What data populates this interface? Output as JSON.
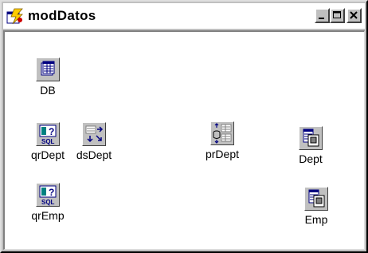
{
  "window": {
    "title": "modDatos",
    "title_color": "#000000",
    "app_icon": "delphi-form-icon",
    "caption_buttons": [
      "minimize-icon",
      "maximize-icon",
      "close-icon"
    ]
  },
  "components": [
    {
      "id": "db",
      "label": "DB",
      "icon": "database-icon"
    },
    {
      "id": "qrdept",
      "label": "qrDept",
      "icon": "sql-query-icon"
    },
    {
      "id": "dsdept",
      "label": "dsDept",
      "icon": "datasource-icon"
    },
    {
      "id": "prdept",
      "label": "prDept",
      "icon": "provider-icon"
    },
    {
      "id": "dept",
      "label": "Dept",
      "icon": "clientdataset-icon"
    },
    {
      "id": "qremp",
      "label": "qrEmp",
      "icon": "sql-query-icon"
    },
    {
      "id": "emp",
      "label": "Emp",
      "icon": "clientdataset-icon"
    }
  ],
  "colors": {
    "face": "#c0c0c0",
    "client": "#ffffff",
    "icon_blue": "#000080",
    "icon_teal": "#008080"
  }
}
